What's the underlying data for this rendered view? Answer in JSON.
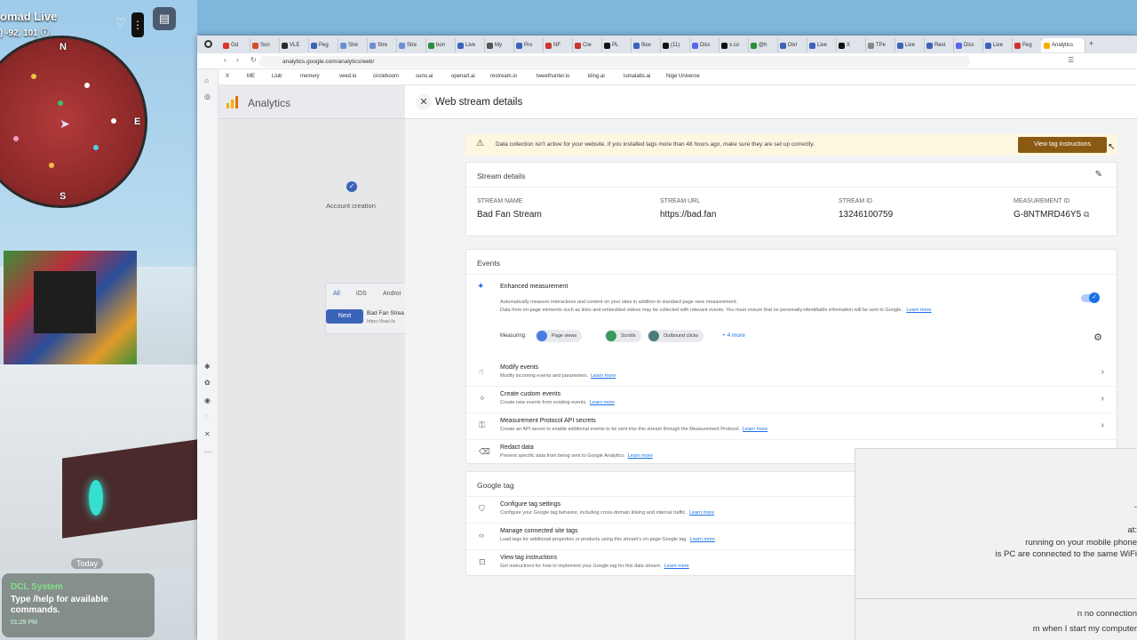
{
  "game": {
    "title": "omad Live",
    "coords": ") -92, 101",
    "compass": {
      "n": "N",
      "e": "E",
      "s": "S"
    },
    "today": "Today",
    "chat": {
      "sender": "DCL System",
      "message": "Type /help for available commands.",
      "time": "01:29 PM"
    }
  },
  "browser": {
    "tabs": [
      "Gd",
      "Sun",
      "VLE",
      "Peg",
      "Stre",
      "Stre",
      "Stre",
      "bon",
      "Live",
      "My",
      "Pro",
      "NF",
      "Cre",
      "PL",
      "flow",
      "(11)",
      "Disc",
      "x.co",
      "@h",
      "Divi",
      "Live",
      "X",
      "TPe",
      "Live",
      "Rest",
      "Disc",
      "Live",
      "Peg"
    ],
    "active_tab": "Analytics",
    "url": "analytics.google.com/analytics/web/",
    "bookmarks": [
      "X",
      "ME",
      "Llub",
      "memery",
      "veed.io",
      "circleboom",
      "suno.ai",
      "openart.ai",
      "restream.io",
      "tweethunter.io",
      "kling.ai",
      "lumalabs.ai",
      "Nige Universe"
    ]
  },
  "ga": {
    "title": "Analytics",
    "step_number": "✓",
    "step_label": "Account creation",
    "platform_tabs": [
      "All",
      "iOS",
      "Androi"
    ],
    "stream_name_partial": "Bad Fan Strea",
    "stream_url_partial": "https://bad.fa",
    "next_label": "Next"
  },
  "panel": {
    "title": "Web stream details",
    "alert": {
      "text": "Data collection isn't active for your website. If you installed tags more than 48 hours ago, make sure they are set up correctly.",
      "button": "View tag instructions"
    },
    "stream_details": {
      "heading": "Stream details",
      "fields": [
        {
          "label": "STREAM NAME",
          "value": "Bad Fan Stream"
        },
        {
          "label": "STREAM URL",
          "value": "https://bad.fan"
        },
        {
          "label": "STREAM ID",
          "value": "13246100759"
        },
        {
          "label": "MEASUREMENT ID",
          "value": "G-8NTMRD46Y5"
        }
      ]
    },
    "events": {
      "heading": "Events",
      "enhanced": {
        "title": "Enhanced measurement",
        "desc1": "Automatically measure interactions and content on your sites in addition to standard page view measurement.",
        "desc2": "Data from on-page elements such as links and embedded videos may be collected with relevant events. You must ensure that no personally-identifiable information will be sent to Google.",
        "learn_more": "Learn more",
        "measuring_label": "Measuring:",
        "chips": [
          "Page views",
          "Scrolls",
          "Outbound clicks"
        ],
        "more": "+ 4 more",
        "enabled": true
      },
      "rows": [
        {
          "title": "Modify events",
          "desc": "Modify incoming events and parameters.",
          "link": "Learn more"
        },
        {
          "title": "Create custom events",
          "desc": "Create new events from existing events.",
          "link": "Learn more"
        },
        {
          "title": "Measurement Protocol API secrets",
          "desc": "Create an API secret to enable additional events to be sent into this stream through the Measurement Protocol.",
          "link": "Learn more"
        },
        {
          "title": "Redact data",
          "desc": "Prevent specific data from being sent to Google Analytics.",
          "link": "Learn more"
        }
      ]
    },
    "google_tag": {
      "heading": "Google tag",
      "rows": [
        {
          "title": "Configure tag settings",
          "desc": "Configure your Google tag behavior, including cross-domain linking and internal traffic.",
          "link": "Learn more"
        },
        {
          "title": "Manage connected site tags",
          "desc": "Load tags for additional properties or products using this stream's on-page Google tag.",
          "link": "Learn more"
        },
        {
          "title": "View tag instructions",
          "desc": "Get instructions for how to implement your Google tag for this data stream.",
          "link": "Learn more"
        }
      ]
    }
  },
  "overlay": {
    "lines": [
      "-",
      "at:",
      "running on your mobile phone",
      "is PC are connected to the same WiFi",
      "n no connection",
      "m when I start my computer"
    ]
  }
}
